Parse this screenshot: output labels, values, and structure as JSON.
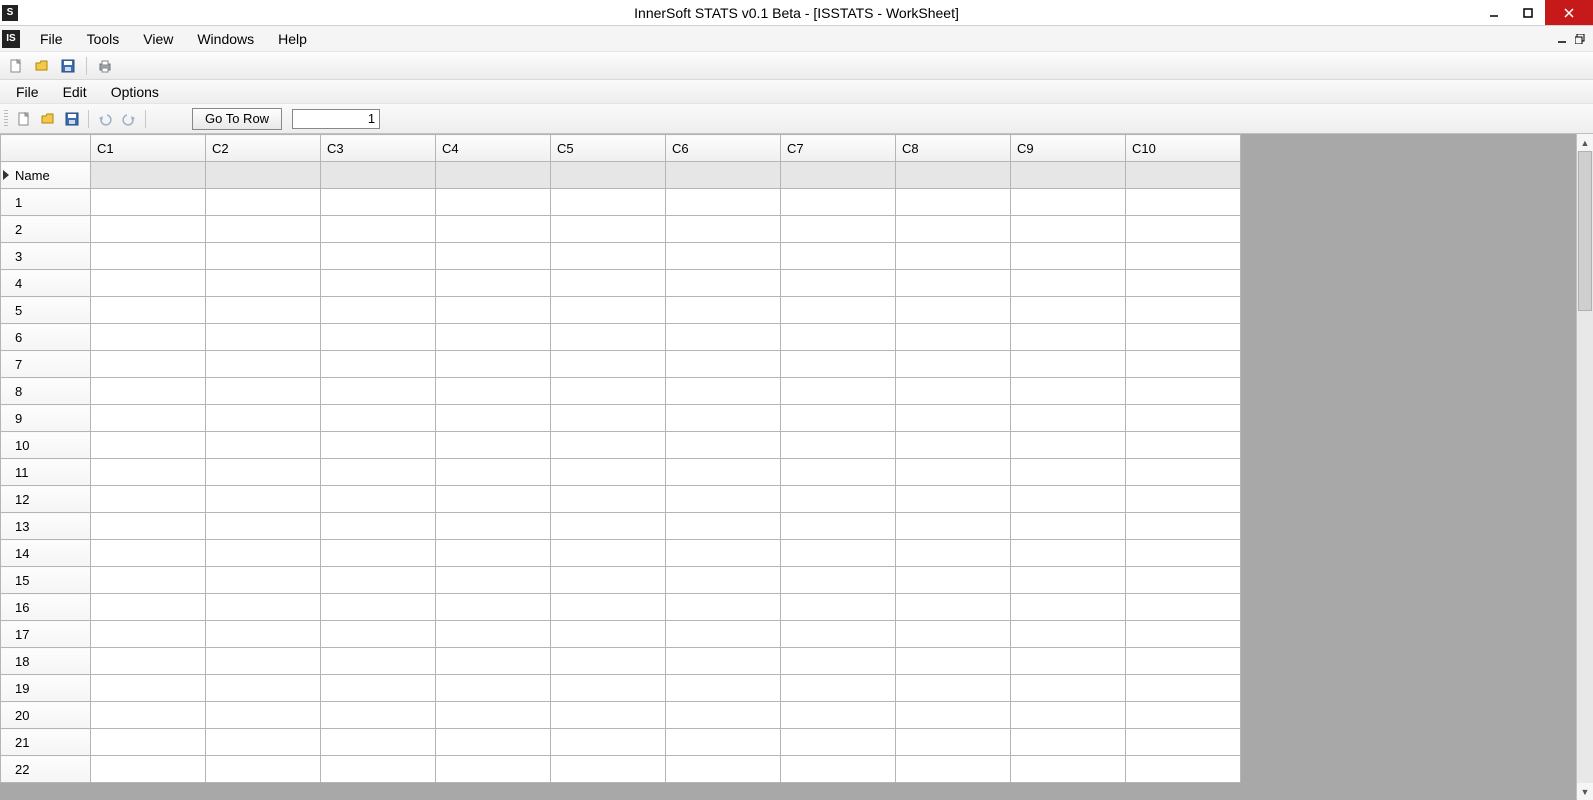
{
  "titlebar": {
    "title": "InnerSoft STATS v0.1 Beta - [ISSTATS - WorkSheet]",
    "icon_text": "S"
  },
  "menubar": {
    "icon_text": "IS",
    "items": [
      "File",
      "Tools",
      "View",
      "Windows",
      "Help"
    ]
  },
  "menubar2": {
    "items": [
      "File",
      "Edit",
      "Options"
    ]
  },
  "toolbar2": {
    "go_to_row_label": "Go To Row",
    "go_to_row_value": "1"
  },
  "sheet": {
    "columns": [
      "C1",
      "C2",
      "C3",
      "C4",
      "C5",
      "C6",
      "C7",
      "C8",
      "C9",
      "C10"
    ],
    "name_row_label": "Name",
    "row_numbers": [
      "1",
      "2",
      "3",
      "4",
      "5",
      "6",
      "7",
      "8",
      "9",
      "10",
      "11",
      "12",
      "13",
      "14",
      "15",
      "16",
      "17",
      "18",
      "19",
      "20",
      "21",
      "22"
    ]
  }
}
